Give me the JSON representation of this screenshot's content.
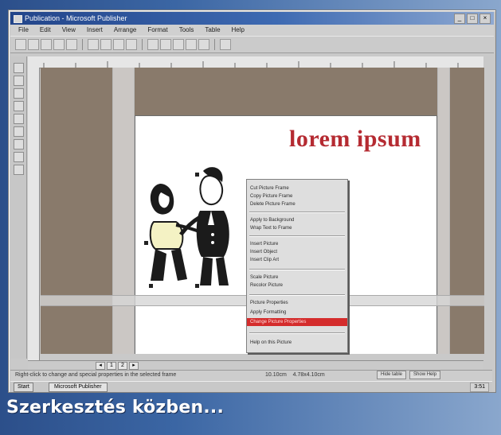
{
  "window": {
    "title": "Publication - Microsoft Publisher",
    "min": "_",
    "max": "□",
    "close": "×"
  },
  "menubar": [
    "File",
    "Edit",
    "View",
    "Insert",
    "Arrange",
    "Format",
    "Tools",
    "Table",
    "Help"
  ],
  "document": {
    "headline": "lorem ipsum"
  },
  "context_menu": {
    "items": [
      "Cut Picture Frame",
      "Copy Picture Frame",
      "Delete Picture Frame",
      "Apply to Background",
      "Wrap Text to Frame",
      "Insert Picture",
      "Insert Object",
      "Insert Clip Art",
      "Scale Picture",
      "Recolor Picture",
      "Picture Properties",
      "Apply Formatting",
      "Change Picture Properties",
      "Help on this Picture"
    ],
    "highlighted_index": 12
  },
  "status": {
    "message": "Right-click to change and special properties in the selected frame",
    "coord_a": "10.10cm",
    "coord_b": "4.78x4.10cm",
    "btn_a": "Hide table",
    "btn_b": "Show Help"
  },
  "taskbar": {
    "start": "Start",
    "task": "Microsoft Publisher",
    "clock": "3:51"
  },
  "caption": "Szerkesztés közben..."
}
